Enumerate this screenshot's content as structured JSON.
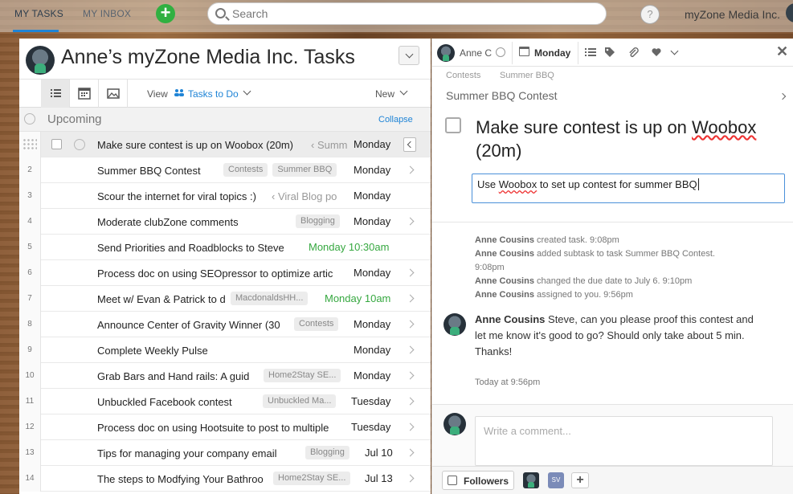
{
  "topbar": {
    "tabs": [
      {
        "label": "MY TASKS",
        "active": true
      },
      {
        "label": "MY INBOX",
        "active": false
      }
    ],
    "add_label": "+",
    "search_placeholder": "Search",
    "help_label": "?",
    "org_name": "myZone Media Inc."
  },
  "left": {
    "title": "Anne’s myZone Media Inc. Tasks",
    "view_label": "View",
    "view_value": "Tasks to Do",
    "new_label": "New",
    "section_label": "Upcoming",
    "collapse_label": "Collapse",
    "rows": [
      {
        "num": "",
        "title": "Make sure contest is up on ",
        "title_mark": "Woobox",
        "title_end": " (20m)",
        "crumb": "‹ Summ",
        "tags": [],
        "due": "Monday",
        "due_green": false,
        "selected": true
      },
      {
        "num": "2",
        "title": "Summer BBQ Contest",
        "tags": [
          "Contests",
          "Summer BBQ"
        ],
        "due": "Monday",
        "due_green": false
      },
      {
        "num": "3",
        "title": "Scour the internet for viral topics :)",
        "crumb": "‹ Viral Blog po",
        "tags": [],
        "due": "Monday",
        "due_green": false
      },
      {
        "num": "4",
        "title": "Moderate clubZone comments",
        "tags": [
          "Blogging"
        ],
        "due": "Monday",
        "due_green": false
      },
      {
        "num": "5",
        "title": "Send Priorities and Roadblocks to Steve",
        "tags": [],
        "due": "Monday 10:30am",
        "due_green": true
      },
      {
        "num": "6",
        "title": "Process doc on using SEOpressor to optimize artic",
        "tags": [],
        "due": "Monday",
        "due_green": false
      },
      {
        "num": "7",
        "title": "Meet w/ Evan & Patrick to d",
        "tags": [
          "MacdonaldsHH..."
        ],
        "due": "Monday 10am",
        "due_green": true
      },
      {
        "num": "8",
        "title": "Announce Center of Gravity Winner (30",
        "tags": [
          "Contests"
        ],
        "due": "Monday",
        "due_green": false
      },
      {
        "num": "9",
        "title": "Complete Weekly Pulse",
        "tags": [],
        "due": "Monday",
        "due_green": false
      },
      {
        "num": "10",
        "title": "Grab Bars and Hand rails: A guid",
        "tags": [
          "Home2Stay SE..."
        ],
        "due": "Monday",
        "due_green": false
      },
      {
        "num": "11",
        "title": "Unbuckled Facebook contest",
        "tags": [
          "Unbuckled Ma..."
        ],
        "due": "Tuesday",
        "due_green": false
      },
      {
        "num": "12",
        "title": "Process doc on using Hootsuite to post to multiple",
        "tags": [],
        "due": "Tuesday",
        "due_green": false
      },
      {
        "num": "13",
        "title": "Tips for managing your company email",
        "tags": [
          "Blogging"
        ],
        "due": "Jul 10",
        "due_green": false
      },
      {
        "num": "14",
        "title": "The steps to Modfying Your Bathroo",
        "tags": [
          "Home2Stay SE..."
        ],
        "due": "Jul 13",
        "due_green": false
      }
    ]
  },
  "right": {
    "assignee": "Anne C",
    "due_date": "Monday",
    "breadcrumbs": [
      "Contests",
      "Summer BBQ"
    ],
    "parent_task": "Summer BBQ Contest",
    "task_title_a": "Make sure contest is up on ",
    "task_title_mark": "Woobox",
    "task_title_b": " (20m)",
    "description_a": "Use ",
    "description_mark": "Woobox",
    "description_b": " to set up contest for summer BBQ",
    "activity": [
      {
        "user": "Anne Cousins",
        "text": " created task.  9:08pm"
      },
      {
        "user": "Anne Cousins",
        "text": " added subtask to task Summer BBQ Contest.  9:08pm"
      },
      {
        "user": "Anne Cousins",
        "text": " changed the due date to July 6.  9:10pm"
      },
      {
        "user": "Anne Cousins",
        "text": " assigned to you.  9:56pm"
      }
    ],
    "comment_user": "Anne Cousins",
    "comment_text": " Steve, can you please proof this contest and let me know it's good to go? Should only take about 5 min. Thanks!",
    "comment_time": "Today at 9:56pm",
    "comment_placeholder": "Write a comment...",
    "followers_label": "Followers",
    "follower_initials": "SV"
  }
}
